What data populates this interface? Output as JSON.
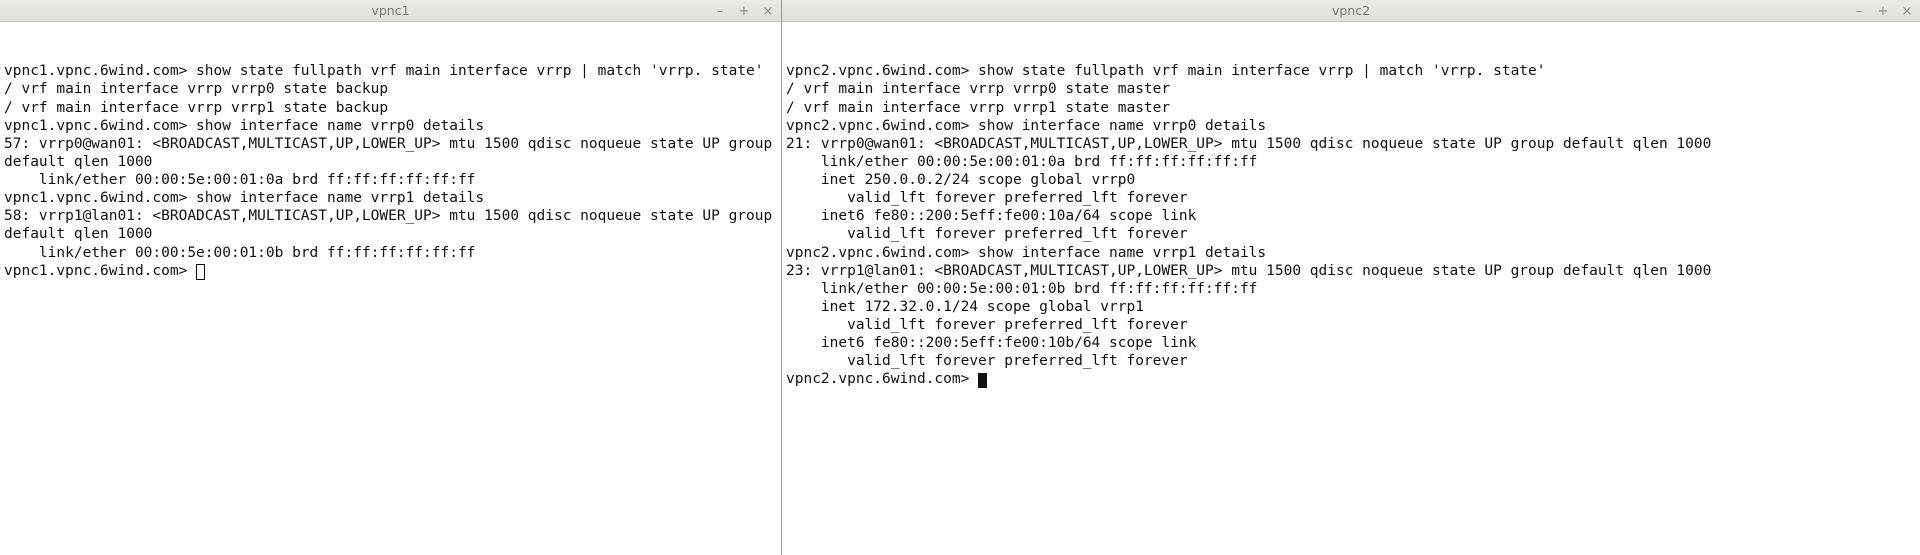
{
  "left": {
    "title": "vpnc1",
    "lines": [
      "vpnc1.vpnc.6wind.com> show state fullpath vrf main interface vrrp | match 'vrrp. state'",
      "/ vrf main interface vrrp vrrp0 state backup",
      "/ vrf main interface vrrp vrrp1 state backup",
      "vpnc1.vpnc.6wind.com> show interface name vrrp0 details",
      "57: vrrp0@wan01: <BROADCAST,MULTICAST,UP,LOWER_UP> mtu 1500 qdisc noqueue state UP group default qlen 1000",
      "    link/ether 00:00:5e:00:01:0a brd ff:ff:ff:ff:ff:ff",
      "vpnc1.vpnc.6wind.com> show interface name vrrp1 details",
      "58: vrrp1@lan01: <BROADCAST,MULTICAST,UP,LOWER_UP> mtu 1500 qdisc noqueue state UP group default qlen 1000",
      "    link/ether 00:00:5e:00:01:0b brd ff:ff:ff:ff:ff:ff"
    ],
    "prompt": "vpnc1.vpnc.6wind.com> ",
    "cursor": "box"
  },
  "right": {
    "title": "vpnc2",
    "lines": [
      "vpnc2.vpnc.6wind.com> show state fullpath vrf main interface vrrp | match 'vrrp. state'",
      "/ vrf main interface vrrp vrrp0 state master",
      "/ vrf main interface vrrp vrrp1 state master",
      "vpnc2.vpnc.6wind.com> show interface name vrrp0 details",
      "21: vrrp0@wan01: <BROADCAST,MULTICAST,UP,LOWER_UP> mtu 1500 qdisc noqueue state UP group default qlen 1000",
      "    link/ether 00:00:5e:00:01:0a brd ff:ff:ff:ff:ff:ff",
      "    inet 250.0.0.2/24 scope global vrrp0",
      "       valid_lft forever preferred_lft forever",
      "    inet6 fe80::200:5eff:fe00:10a/64 scope link",
      "       valid_lft forever preferred_lft forever",
      "vpnc2.vpnc.6wind.com> show interface name vrrp1 details",
      "23: vrrp1@lan01: <BROADCAST,MULTICAST,UP,LOWER_UP> mtu 1500 qdisc noqueue state UP group default qlen 1000",
      "    link/ether 00:00:5e:00:01:0b brd ff:ff:ff:ff:ff:ff",
      "    inet 172.32.0.1/24 scope global vrrp1",
      "       valid_lft forever preferred_lft forever",
      "    inet6 fe80::200:5eff:fe00:10b/64 scope link",
      "       valid_lft forever preferred_lft forever"
    ],
    "prompt": "vpnc2.vpnc.6wind.com> ",
    "cursor": "block"
  },
  "window_buttons": {
    "minimize": "–",
    "maximize": "+",
    "close": "×"
  }
}
